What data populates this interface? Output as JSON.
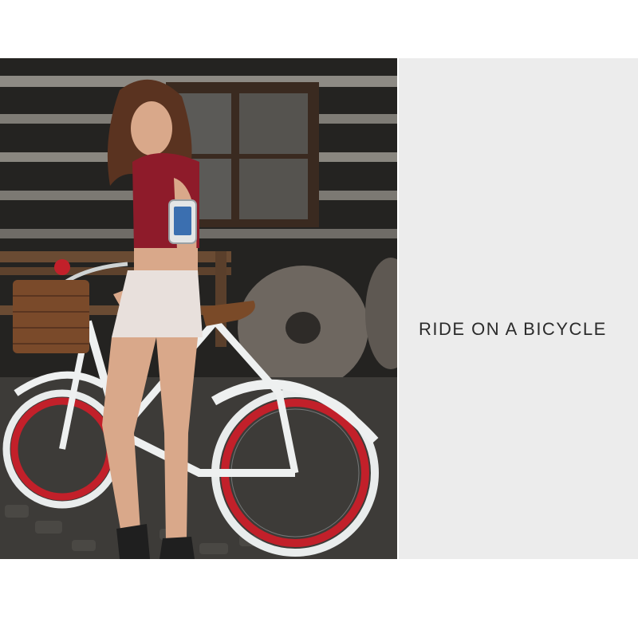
{
  "caption": {
    "text": "RIDE ON A BICYCLE"
  },
  "photo": {
    "subject": "woman-with-bicycle-and-phone-armband"
  },
  "colors": {
    "panel_background": "#ececec",
    "caption_text": "#2b2b2b",
    "top_red": "#8e1b2a",
    "bicycle_frame": "#eef0f0",
    "tire_accent": "#c2202a"
  }
}
